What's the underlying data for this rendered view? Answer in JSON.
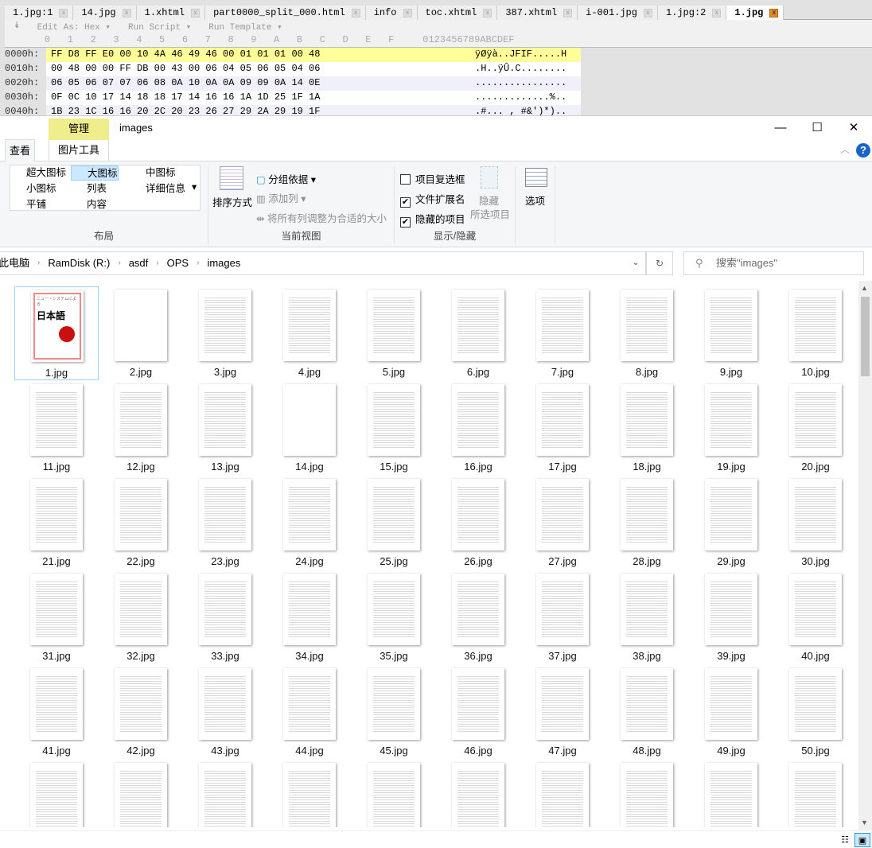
{
  "hex_editor": {
    "tabs": [
      {
        "label": "1.jpg:1"
      },
      {
        "label": "14.jpg"
      },
      {
        "label": "1.xhtml"
      },
      {
        "label": "part0000_split_000.html"
      },
      {
        "label": "info"
      },
      {
        "label": "toc.xhtml"
      },
      {
        "label": "387.xhtml"
      },
      {
        "label": "i-001.jpg"
      },
      {
        "label": "1.jpg:2"
      },
      {
        "label": "1.jpg",
        "active": true
      }
    ],
    "toolbar": {
      "edit_as": "Edit As: Hex ▾",
      "run_script": "Run Script ▾",
      "run_template": "Run Template ▾"
    },
    "column_header": "0   1   2   3   4   5   6   7   8   9   A   B   C   D   E   F     0123456789ABCDEF",
    "rows": [
      {
        "addr": "0000h:",
        "bytes": "FF D8 FF E0 00 10 4A 46 49 46 00 01 01 01 00 48",
        "ascii": "ÿØÿà..JFIF.....H"
      },
      {
        "addr": "0010h:",
        "bytes": "00 48 00 00 FF DB 00 43 00 06 04 05 06 05 04 06",
        "ascii": ".H..ÿÛ.C........"
      },
      {
        "addr": "0020h:",
        "bytes": "06 05 06 07 07 06 08 0A 10 0A 0A 09 09 0A 14 0E",
        "ascii": "................"
      },
      {
        "addr": "0030h:",
        "bytes": "0F 0C 10 17 14 18 18 17 14 16 16 1A 1D 25 1F 1A",
        "ascii": ".............%.."
      },
      {
        "addr": "0040h:",
        "bytes": "1B 23 1C 16 16 20 2C 20 23 26 27 29 2A 29 19 1F",
        "ascii": ".#... , #&')*).."
      }
    ]
  },
  "explorer": {
    "context_tab": "管理",
    "window_title": "images",
    "ribbon_tabs": {
      "view": "查看",
      "picture_tools": "图片工具"
    },
    "window_buttons": {
      "minimize": "—",
      "maximize": "☐",
      "close": "✕"
    },
    "help": "?",
    "layout": {
      "items": [
        "超大图标",
        "大图标",
        "中图标",
        "小图标",
        "列表",
        "详细信息",
        "平铺",
        "内容"
      ],
      "selected": "大图标",
      "group": "布局"
    },
    "current_view": {
      "sort": "排序方式",
      "group_by": "分组依据",
      "add_column": "添加列",
      "fit_columns": "将所有列调整为合适的大小",
      "group": "当前视图"
    },
    "show_hide": {
      "item_checkboxes": "项目复选框",
      "item_checkboxes_checked": false,
      "file_extensions": "文件扩展名",
      "file_extensions_checked": true,
      "hidden_items": "隐藏的项目",
      "hidden_items_checked": true,
      "hide_selected_1": "隐藏",
      "hide_selected_2": "所选项目",
      "group": "显示/隐藏"
    },
    "options": "选项",
    "breadcrumb": [
      "此电脑",
      "RamDisk (R:)",
      "asdf",
      "OPS",
      "images"
    ],
    "search_placeholder": "搜索\"images\"",
    "cover": {
      "line1": "ニュー・システムによる",
      "line2": "日本語"
    },
    "files": [
      "1.jpg",
      "2.jpg",
      "3.jpg",
      "4.jpg",
      "5.jpg",
      "6.jpg",
      "7.jpg",
      "8.jpg",
      "9.jpg",
      "10.jpg",
      "11.jpg",
      "12.jpg",
      "13.jpg",
      "14.jpg",
      "15.jpg",
      "16.jpg",
      "17.jpg",
      "18.jpg",
      "19.jpg",
      "20.jpg",
      "21.jpg",
      "22.jpg",
      "23.jpg",
      "24.jpg",
      "25.jpg",
      "26.jpg",
      "27.jpg",
      "28.jpg",
      "29.jpg",
      "30.jpg",
      "31.jpg",
      "32.jpg",
      "33.jpg",
      "34.jpg",
      "35.jpg",
      "36.jpg",
      "37.jpg",
      "38.jpg",
      "39.jpg",
      "40.jpg",
      "41.jpg",
      "42.jpg",
      "43.jpg",
      "44.jpg",
      "45.jpg",
      "46.jpg",
      "47.jpg",
      "48.jpg",
      "49.jpg",
      "50.jpg"
    ],
    "selected_file": "1.jpg",
    "blank_thumbs": [
      "2.jpg",
      "14.jpg"
    ]
  }
}
